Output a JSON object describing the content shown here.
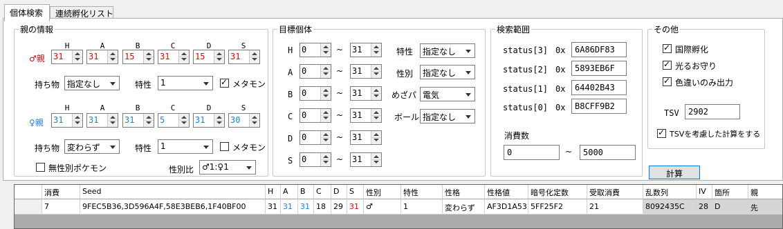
{
  "tabs": [
    {
      "label": "個体検索",
      "active": true
    },
    {
      "label": "連続孵化リスト",
      "active": false
    }
  ],
  "parents": {
    "title": "親の情報",
    "stat_headers": [
      "H",
      "A",
      "B",
      "C",
      "D",
      "S"
    ],
    "male": {
      "label": "♂親",
      "ivs": [
        "31",
        "31",
        "15",
        "31",
        "15",
        "31"
      ],
      "item_label": "持ち物",
      "item": "指定なし",
      "ability_label": "特性",
      "ability": "1",
      "ditto_label": "メタモン",
      "ditto": true
    },
    "female": {
      "label": "♀親",
      "ivs": [
        "31",
        "31",
        "31",
        "5",
        "31",
        "30"
      ],
      "item_label": "持ち物",
      "item": "変わらず",
      "ability_label": "特性",
      "ability": "1",
      "ditto_label": "メタモン",
      "ditto": false
    },
    "genderless_label": "無性別ポケモン",
    "genderless": false,
    "gender_ratio_label": "性別比",
    "gender_ratio": "♂1:♀1"
  },
  "target": {
    "title": "目標個体",
    "tilde": "~",
    "rows": [
      {
        "stat": "H",
        "min": "0",
        "max": "31"
      },
      {
        "stat": "A",
        "min": "0",
        "max": "31"
      },
      {
        "stat": "B",
        "min": "0",
        "max": "31"
      },
      {
        "stat": "C",
        "min": "0",
        "max": "31"
      },
      {
        "stat": "D",
        "min": "0",
        "max": "31"
      },
      {
        "stat": "S",
        "min": "0",
        "max": "31"
      }
    ],
    "ability_label": "特性",
    "ability": "指定なし",
    "gender_label": "性別",
    "gender": "指定なし",
    "pause_label": "めざパ",
    "pause": "電気",
    "ball_label": "ボール",
    "ball": "指定なし"
  },
  "search_range": {
    "title": "検索範囲",
    "prefix": "0x",
    "status": [
      {
        "label": "status[3]",
        "value": "6A86DF83"
      },
      {
        "label": "status[2]",
        "value": "5893EB6F"
      },
      {
        "label": "status[1]",
        "value": "64402B43"
      },
      {
        "label": "status[0]",
        "value": "B8CFF9B2"
      }
    ],
    "consumption_label": "消費数",
    "from": "0",
    "tilde": "~",
    "to": "5000"
  },
  "other": {
    "title": "その他",
    "options": [
      {
        "label": "国際孵化",
        "checked": true
      },
      {
        "label": "光るお守り",
        "checked": true
      },
      {
        "label": "色違いのみ出力",
        "checked": true
      }
    ],
    "tsv_label": "TSV",
    "tsv": "2902",
    "consider_tsv_label": "TSVを考慮した計算をする",
    "consider_tsv": true
  },
  "calc_button": "計算",
  "results": {
    "headers": [
      "",
      "消費",
      "Seed",
      "H",
      "A",
      "B",
      "C",
      "D",
      "S",
      "性別",
      "特性",
      "性格",
      "性格値",
      "暗号化定数",
      "受取消費",
      "乱数列",
      "IV",
      "箇所",
      "親"
    ],
    "rows": [
      {
        "consumption": "7",
        "seed": "9FEC5B36,3D596A4F,58E3BEB6,1F40BF00",
        "h": "31",
        "a": "31",
        "b": "31",
        "c": "18",
        "d": "29",
        "s": "31",
        "gender": "♂",
        "ability": "1",
        "nature": "変わらず",
        "pid": "AF3D1A53",
        "ec": "5FF25F2",
        "receive": "21",
        "rng": "8092435C",
        "iv": "28",
        "location": "D",
        "parent": "先"
      }
    ]
  }
}
